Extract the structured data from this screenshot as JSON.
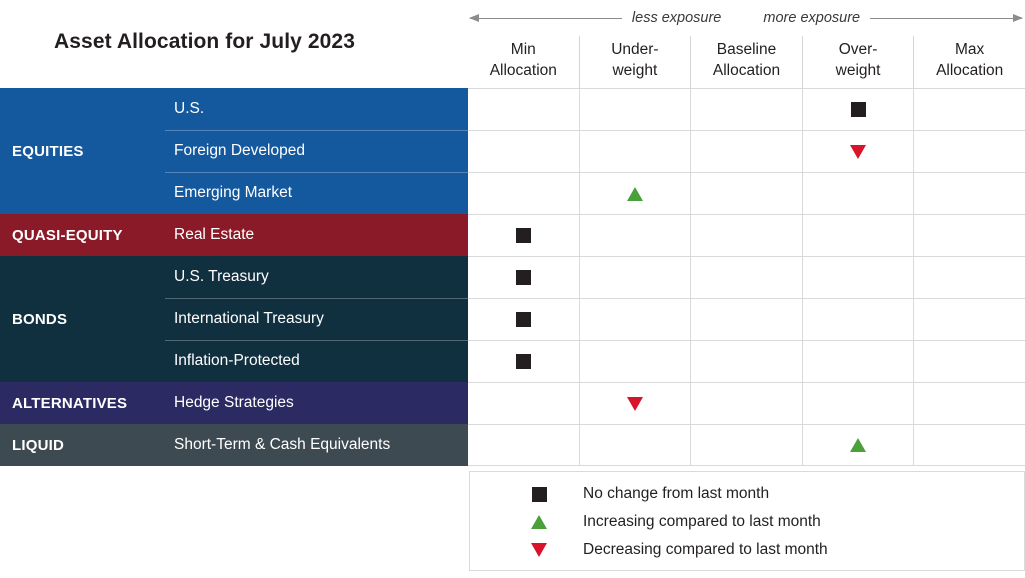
{
  "title": "Asset Allocation for July 2023",
  "exposure": {
    "less_label": "less exposure",
    "more_label": "more exposure"
  },
  "columns": [
    {
      "line1": "Min",
      "line2": "Allocation"
    },
    {
      "line1": "Under-",
      "line2": "weight"
    },
    {
      "line1": "Baseline",
      "line2": "Allocation"
    },
    {
      "line1": "Over-",
      "line2": "weight"
    },
    {
      "line1": "Max",
      "line2": "Allocation"
    }
  ],
  "colors": {
    "equities": "#14589e",
    "quasi_equity": "#8b1a28",
    "bonds": "#10303f",
    "alternatives": "#2b2a63",
    "liquid": "#3e4a52",
    "no_change": "#231f20",
    "increasing": "#4ca03c",
    "decreasing": "#d8132a"
  },
  "categories": [
    {
      "label": "EQUITIES",
      "rows": [
        {
          "name": "U.S.",
          "marker": "square",
          "column": 3
        },
        {
          "name": "Foreign Developed",
          "marker": "down",
          "column": 3
        },
        {
          "name": "Emerging Market",
          "marker": "up",
          "column": 1
        }
      ]
    },
    {
      "label": "QUASI-EQUITY",
      "rows": [
        {
          "name": "Real Estate",
          "marker": "square",
          "column": 0
        }
      ]
    },
    {
      "label": "BONDS",
      "rows": [
        {
          "name": "U.S. Treasury",
          "marker": "square",
          "column": 0
        },
        {
          "name": "International Treasury",
          "marker": "square",
          "column": 0
        },
        {
          "name": "Inflation-Protected",
          "marker": "square",
          "column": 0
        }
      ]
    },
    {
      "label": "ALTERNATIVES",
      "rows": [
        {
          "name": "Hedge Strategies",
          "marker": "down",
          "column": 1
        }
      ]
    },
    {
      "label": "LIQUID",
      "rows": [
        {
          "name": "Short-Term & Cash Equivalents",
          "marker": "up",
          "column": 3
        }
      ]
    }
  ],
  "legend": [
    {
      "marker": "square",
      "text": "No change from last month"
    },
    {
      "marker": "up",
      "text": "Increasing compared to last month"
    },
    {
      "marker": "down",
      "text": "Decreasing compared to last month"
    }
  ]
}
